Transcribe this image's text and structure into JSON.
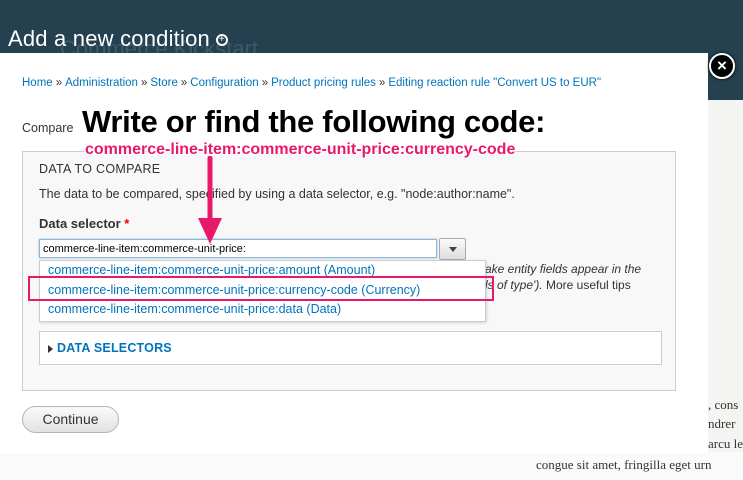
{
  "background": {
    "title": "Add a new condition",
    "ghost_title": "Commerce Kickstart",
    "body_lines": [
      ", cons",
      "ndrer",
      "arcu le",
      "congue sit amet, fringilla eget urn"
    ]
  },
  "modal": {
    "breadcrumb": [
      "Home",
      "Administration",
      "Store",
      "Configuration",
      "Product pricing rules",
      "Editing reaction rule \"Convert US to EUR\""
    ],
    "breadcrumb_sep": "»",
    "compare_label": "Compare",
    "fieldset": {
      "legend": "DATA TO COMPARE",
      "description": "The data to be compared, specified by using a data selector, e.g. \"node:author:name\".",
      "selector_label": "Data selector",
      "required_mark": "*",
      "selector_value": "commerce-line-item:commerce-unit-price:",
      "hint_line1": "ake entity fields appear in the",
      "hint_line2_em": "ls of type').",
      "hint_line2_rest": " More useful tips"
    },
    "autocomplete": [
      "commerce-line-item:commerce-unit-price:amount (Amount)",
      "commerce-line-item:commerce-unit-price:currency-code (Currency)",
      "commerce-line-item:commerce-unit-price:data (Data)"
    ],
    "data_selectors_label": "DATA SELECTORS",
    "continue_label": "Continue",
    "close_label": "×"
  },
  "annotation": {
    "heading": "Write or find the following code:",
    "code": "commerce-line-item:commerce-unit-price:currency-code",
    "accent_color": "#e8186a"
  }
}
